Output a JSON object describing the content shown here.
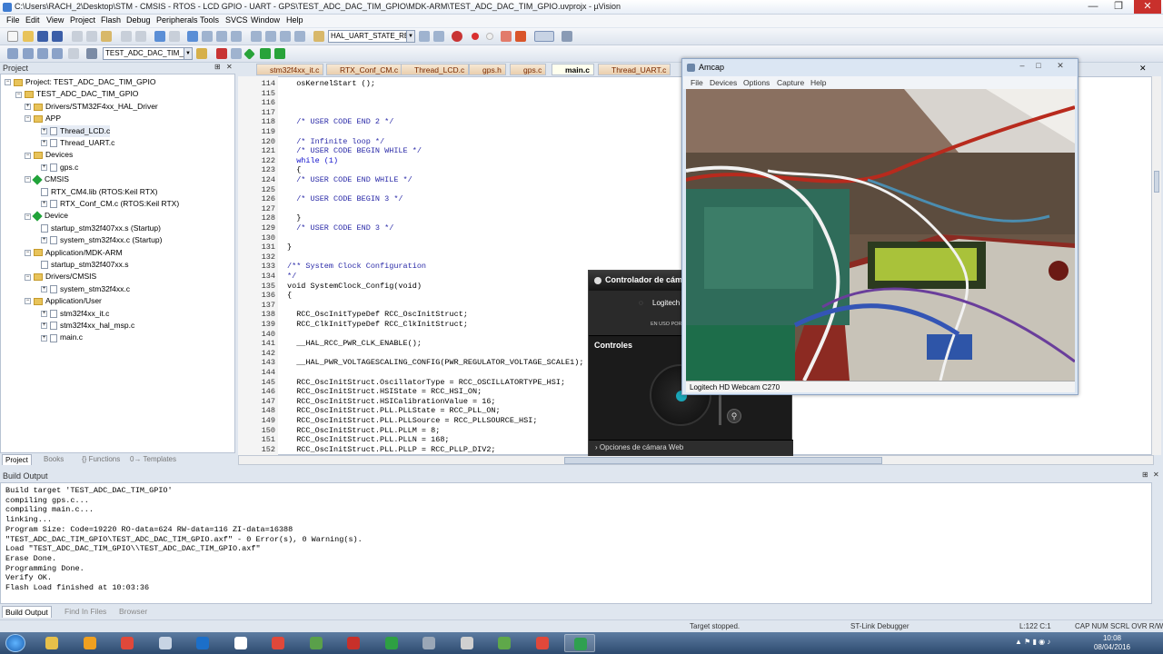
{
  "window": {
    "title": "C:\\Users\\RACH_2\\Desktop\\STM - CMSIS - RTOS - LCD GPIO - UART - GPS\\TEST_ADC_DAC_TIM_GPIO\\MDK-ARM\\TEST_ADC_DAC_TIM_GPIO.uvprojx - µVision",
    "minimize": "—",
    "maximize": "❐",
    "close": "✕"
  },
  "menu": [
    "File",
    "Edit",
    "View",
    "Project",
    "Flash",
    "Debug",
    "Peripherals",
    "Tools",
    "SVCS",
    "Window",
    "Help"
  ],
  "toolbar": {
    "find_combo": "HAL_UART_STATE_READY",
    "target_combo": "TEST_ADC_DAC_TIM_GPIO"
  },
  "project": {
    "header": "Project",
    "tree": [
      {
        "label": "Project: TEST_ADC_DAC_TIM_GPIO",
        "level": 0,
        "kind": "root",
        "exp": "−"
      },
      {
        "label": "TEST_ADC_DAC_TIM_GPIO",
        "level": 1,
        "kind": "folder",
        "exp": "−"
      },
      {
        "label": "Drivers/STM32F4xx_HAL_Driver",
        "level": 2,
        "kind": "folder",
        "exp": "+"
      },
      {
        "label": "APP",
        "level": 2,
        "kind": "folder",
        "exp": "−"
      },
      {
        "label": "Thread_LCD.c",
        "level": 3,
        "kind": "file",
        "exp": "+"
      },
      {
        "label": "Thread_UART.c",
        "level": 3,
        "kind": "file",
        "exp": "+"
      },
      {
        "label": "Devices",
        "level": 2,
        "kind": "folder",
        "exp": "−"
      },
      {
        "label": "gps.c",
        "level": 3,
        "kind": "file",
        "exp": "+"
      },
      {
        "label": "CMSIS",
        "level": 2,
        "kind": "gem",
        "exp": "−"
      },
      {
        "label": "RTX_CM4.lib (RTOS:Keil RTX)",
        "level": 3,
        "kind": "file",
        "exp": ""
      },
      {
        "label": "RTX_Conf_CM.c (RTOS:Keil RTX)",
        "level": 3,
        "kind": "file",
        "exp": "+"
      },
      {
        "label": "Device",
        "level": 2,
        "kind": "gem",
        "exp": "−"
      },
      {
        "label": "startup_stm32f407xx.s (Startup)",
        "level": 3,
        "kind": "file",
        "exp": ""
      },
      {
        "label": "system_stm32f4xx.c (Startup)",
        "level": 3,
        "kind": "file",
        "exp": "+"
      },
      {
        "label": "Application/MDK-ARM",
        "level": 2,
        "kind": "folder",
        "exp": "−"
      },
      {
        "label": "startup_stm32f407xx.s",
        "level": 3,
        "kind": "file",
        "exp": ""
      },
      {
        "label": "Drivers/CMSIS",
        "level": 2,
        "kind": "folder",
        "exp": "−"
      },
      {
        "label": "system_stm32f4xx.c",
        "level": 3,
        "kind": "file",
        "exp": "+"
      },
      {
        "label": "Application/User",
        "level": 2,
        "kind": "folder",
        "exp": "−"
      },
      {
        "label": "stm32f4xx_it.c",
        "level": 3,
        "kind": "file",
        "exp": "+"
      },
      {
        "label": "stm32f4xx_hal_msp.c",
        "level": 3,
        "kind": "file",
        "exp": "+"
      },
      {
        "label": "main.c",
        "level": 3,
        "kind": "file",
        "exp": "+"
      }
    ],
    "tabs": [
      "Project",
      "Books",
      "{} Functions",
      "0→ Templates"
    ]
  },
  "editor": {
    "tabs": [
      "stm32f4xx_it.c",
      "RTX_Conf_CM.c",
      "Thread_LCD.c",
      "gps.h",
      "gps.c",
      "main.c",
      "Thread_UART.c"
    ],
    "active_tab": "main.c",
    "lines": [
      {
        "n": "114",
        "t": "  osKernelStart ();",
        "k": ""
      },
      {
        "n": "115",
        "t": "",
        "k": ""
      },
      {
        "n": "116",
        "t": "",
        "k": ""
      },
      {
        "n": "117",
        "t": "",
        "k": ""
      },
      {
        "n": "118",
        "t": "  /* USER CODE END 2 */",
        "k": "c"
      },
      {
        "n": "119",
        "t": "",
        "k": ""
      },
      {
        "n": "120",
        "t": "  /* Infinite loop */",
        "k": "c"
      },
      {
        "n": "121",
        "t": "  /* USER CODE BEGIN WHILE */",
        "k": "c"
      },
      {
        "n": "122",
        "t": "  while (1)",
        "k": "kw"
      },
      {
        "n": "123",
        "t": "  {",
        "k": ""
      },
      {
        "n": "124",
        "t": "  /* USER CODE END WHILE */",
        "k": "c"
      },
      {
        "n": "125",
        "t": "",
        "k": ""
      },
      {
        "n": "126",
        "t": "  /* USER CODE BEGIN 3 */",
        "k": "c"
      },
      {
        "n": "127",
        "t": "",
        "k": ""
      },
      {
        "n": "128",
        "t": "  }",
        "k": ""
      },
      {
        "n": "129",
        "t": "  /* USER CODE END 3 */",
        "k": "c"
      },
      {
        "n": "130",
        "t": "",
        "k": ""
      },
      {
        "n": "131",
        "t": "}",
        "k": ""
      },
      {
        "n": "132",
        "t": "",
        "k": ""
      },
      {
        "n": "133",
        "t": "/** System Clock Configuration",
        "k": "c"
      },
      {
        "n": "134",
        "t": "*/",
        "k": "c"
      },
      {
        "n": "135",
        "t": "void SystemClock_Config(void)",
        "k": ""
      },
      {
        "n": "136",
        "t": "{",
        "k": ""
      },
      {
        "n": "137",
        "t": "",
        "k": ""
      },
      {
        "n": "138",
        "t": "  RCC_OscInitTypeDef RCC_OscInitStruct;",
        "k": ""
      },
      {
        "n": "139",
        "t": "  RCC_ClkInitTypeDef RCC_ClkInitStruct;",
        "k": ""
      },
      {
        "n": "140",
        "t": "",
        "k": ""
      },
      {
        "n": "141",
        "t": "  __HAL_RCC_PWR_CLK_ENABLE();",
        "k": ""
      },
      {
        "n": "142",
        "t": "",
        "k": ""
      },
      {
        "n": "143",
        "t": "  __HAL_PWR_VOLTAGESCALING_CONFIG(PWR_REGULATOR_VOLTAGE_SCALE1);",
        "k": ""
      },
      {
        "n": "144",
        "t": "",
        "k": ""
      },
      {
        "n": "145",
        "t": "  RCC_OscInitStruct.OscillatorType = RCC_OSCILLATORTYPE_HSI;",
        "k": ""
      },
      {
        "n": "146",
        "t": "  RCC_OscInitStruct.HSIState = RCC_HSI_ON;",
        "k": ""
      },
      {
        "n": "147",
        "t": "  RCC_OscInitStruct.HSICalibrationValue = 16;",
        "k": ""
      },
      {
        "n": "148",
        "t": "  RCC_OscInitStruct.PLL.PLLState = RCC_PLL_ON;",
        "k": ""
      },
      {
        "n": "149",
        "t": "  RCC_OscInitStruct.PLL.PLLSource = RCC_PLLSOURCE_HSI;",
        "k": ""
      },
      {
        "n": "150",
        "t": "  RCC_OscInitStruct.PLL.PLLM = 8;",
        "k": ""
      },
      {
        "n": "151",
        "t": "  RCC_OscInitStruct.PLL.PLLN = 168;",
        "k": ""
      },
      {
        "n": "152",
        "t": "  RCC_OscInitStruct.PLL.PLLP = RCC_PLLP_DIV2;",
        "k": ""
      }
    ]
  },
  "build": {
    "header": "Build Output",
    "lines": [
      "Build target 'TEST_ADC_DAC_TIM_GPIO'",
      "compiling gps.c...",
      "compiling main.c...",
      "linking...",
      "Program Size: Code=19220 RO-data=624 RW-data=116 ZI-data=16388",
      "\"TEST_ADC_DAC_TIM_GPIO\\TEST_ADC_DAC_TIM_GPIO.axf\" - 0 Error(s), 0 Warning(s).",
      "Load \"TEST_ADC_DAC_TIM_GPIO\\\\TEST_ADC_DAC_TIM_GPIO.axf\"",
      "Erase Done.",
      "Programming Done.",
      "Verify OK.",
      "Flash Load finished at 10:03:36"
    ],
    "tabs": [
      "Build Output",
      "Find In Files",
      "Browser"
    ]
  },
  "status": {
    "target": "Target stopped.",
    "debugger": "ST-Link Debugger",
    "position": "L:122 C:1",
    "keys": "CAP  NUM  SCRL  OVR  R/W"
  },
  "cam_controller": {
    "title": "Controlador de cáma",
    "device": "Logitech",
    "in_use": "EN USO POR",
    "controls": "Controles",
    "zoom": "⚲",
    "options": "› Opciones de cámara Web"
  },
  "amcap": {
    "title": "Amcap",
    "menu": [
      "File",
      "Devices",
      "Options",
      "Capture",
      "Help"
    ],
    "caption": "Logitech HD Webcam C270"
  },
  "taskbar": {
    "time": "10:08",
    "date": "08/04/2016",
    "apps": [
      {
        "icon": "explorer-icon",
        "color": "#e7c04a"
      },
      {
        "icon": "media-player-icon",
        "color": "#f0a020"
      },
      {
        "icon": "chrome-icon",
        "color": "#e0483a"
      },
      {
        "icon": "calculator-icon",
        "color": "#c8d4e4"
      },
      {
        "icon": "outlook-icon",
        "color": "#1c6fc9"
      },
      {
        "icon": "download-icon",
        "color": "#ffffff"
      },
      {
        "icon": "chrome-icon",
        "color": "#e0483a"
      },
      {
        "icon": "circuit-icon",
        "color": "#5aa04a"
      },
      {
        "icon": "pdf-icon",
        "color": "#c8302a"
      },
      {
        "icon": "codewarrior-icon",
        "color": "#2ea043"
      },
      {
        "icon": "board-icon",
        "color": "#9aa7b7"
      },
      {
        "icon": "webcam-icon",
        "color": "#d0d0d0"
      },
      {
        "icon": "chart-icon",
        "color": "#5fa84a"
      },
      {
        "icon": "chrome-icon",
        "color": "#e0483a"
      },
      {
        "icon": "keil-icon",
        "color": "#2fa050"
      }
    ]
  }
}
